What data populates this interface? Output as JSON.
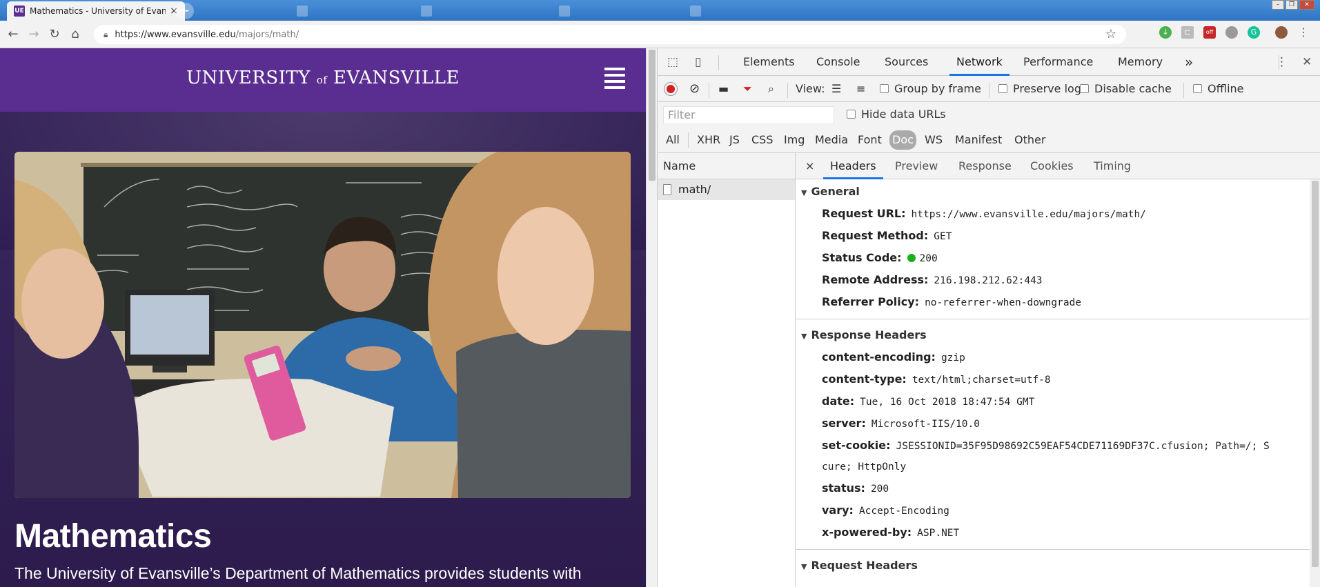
{
  "browser": {
    "active_tab_title": "Mathematics - University of Evansville",
    "active_tab_favicon": "UE",
    "tab_close": "×",
    "new_tab": "+",
    "url_host": "https://www.evansville.edu",
    "url_path": "/majors/math/"
  },
  "page": {
    "university_name_1": "UNIVERSITY",
    "university_name_of": "of",
    "university_name_2": "EVANSVILLE",
    "heading": "Mathematics",
    "intro": "The University of Evansville’s Department of Mathematics provides students with"
  },
  "devtools": {
    "tabs": [
      "Elements",
      "Console",
      "Sources",
      "Network",
      "Performance",
      "Memory"
    ],
    "more_tabs": "»",
    "active_tab": "Network",
    "toolbar": {
      "view_label": "View:",
      "group_by_frame": "Group by frame",
      "preserve_log": "Preserve log",
      "disable_cache": "Disable cache",
      "offline": "Offline"
    },
    "filter_placeholder": "Filter",
    "hide_data_urls": "Hide data URLs",
    "type_filters": [
      "All",
      "XHR",
      "JS",
      "CSS",
      "Img",
      "Media",
      "Font",
      "Doc",
      "WS",
      "Manifest",
      "Other"
    ],
    "active_type_filter": "Doc",
    "name_column_header": "Name",
    "requests": [
      "math/"
    ],
    "detail_close": "×",
    "detail_tabs": [
      "Headers",
      "Preview",
      "Response",
      "Cookies",
      "Timing"
    ],
    "active_detail_tab": "Headers",
    "general": {
      "title": "General",
      "request_url_label": "Request URL:",
      "request_url": "https://www.evansville.edu/majors/math/",
      "request_method_label": "Request Method:",
      "request_method": "GET",
      "status_code_label": "Status Code:",
      "status_code": "200",
      "remote_address_label": "Remote Address:",
      "remote_address": "216.198.212.62:443",
      "referrer_policy_label": "Referrer Policy:",
      "referrer_policy": "no-referrer-when-downgrade"
    },
    "response_headers": {
      "title": "Response Headers",
      "items": [
        {
          "k": "content-encoding:",
          "v": "gzip"
        },
        {
          "k": "content-type:",
          "v": "text/html;charset=utf-8"
        },
        {
          "k": "date:",
          "v": "Tue, 16 Oct 2018 18:47:54 GMT"
        },
        {
          "k": "server:",
          "v": "Microsoft-IIS/10.0"
        },
        {
          "k": "set-cookie:",
          "v": "JSESSIONID=35F95D98692C59EAF54CDE71169DF37C.cfusion; Path=/; S"
        },
        {
          "k": "",
          "v": "cure; HttpOnly"
        },
        {
          "k": "status:",
          "v": "200"
        },
        {
          "k": "vary:",
          "v": "Accept-Encoding"
        },
        {
          "k": "x-powered-by:",
          "v": "ASP.NET"
        }
      ]
    },
    "request_headers": {
      "title": "Request Headers"
    }
  },
  "colors": {
    "brand_purple": "#5a2d91",
    "status_green": "#19b019",
    "record_red": "#d32020",
    "active_blue": "#1a73e8"
  }
}
